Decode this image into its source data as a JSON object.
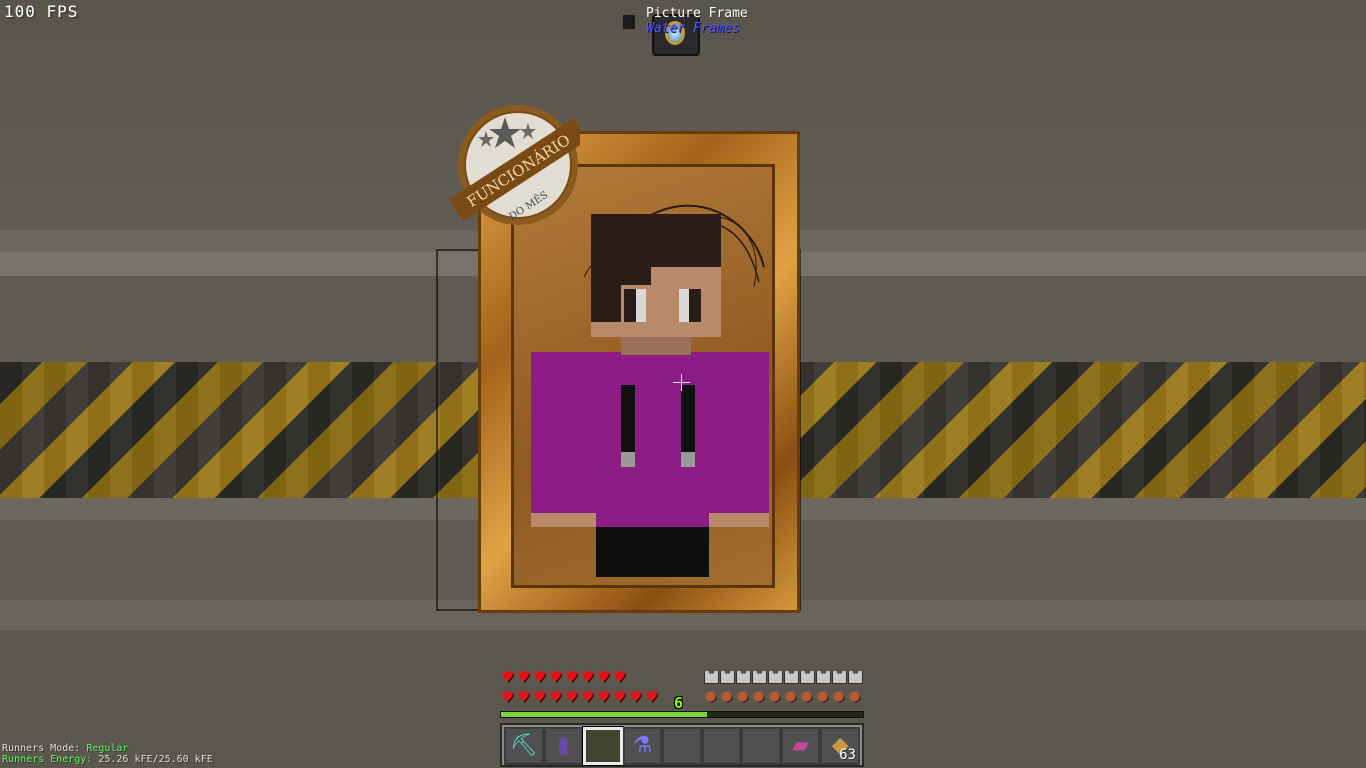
{
  "hud": {
    "fps": "100 FPS",
    "level": "6",
    "hearts_row1": 8,
    "hearts_row2": 10,
    "armor_points": 10,
    "hunger_points": 10,
    "xp_progress": 0.57
  },
  "waila": {
    "block_name": "Picture Frame",
    "mod_name": "Water Frames"
  },
  "painting": {
    "badge_line1": "FUNCIONÁRIO",
    "badge_line2": "DO MÊS"
  },
  "runners": {
    "mode_label": "Runners Mode:",
    "mode_value": "Regular",
    "energy_label": "Runners Energy:",
    "energy_value": "25.26 kFE/25.60 kFE"
  },
  "hotbar": {
    "selected_index": 2,
    "slots": [
      {
        "icon": "diamond-pickaxe-icon",
        "glyph": "⛏",
        "color": "#4fe0d0",
        "count": ""
      },
      {
        "icon": "purple-block-icon",
        "glyph": "▮",
        "color": "#6a4aa8",
        "count": ""
      },
      {
        "icon": "empty-slot",
        "glyph": "",
        "color": "#000000",
        "count": ""
      },
      {
        "icon": "potion-icon",
        "glyph": "⚗",
        "color": "#7a7aff",
        "count": ""
      },
      {
        "icon": "empty-slot",
        "glyph": "",
        "color": "#000000",
        "count": ""
      },
      {
        "icon": "empty-slot",
        "glyph": "",
        "color": "#000000",
        "count": ""
      },
      {
        "icon": "empty-slot",
        "glyph": "",
        "color": "#000000",
        "count": ""
      },
      {
        "icon": "enchanted-book-icon",
        "glyph": "▰",
        "color": "#c04a9a",
        "count": ""
      },
      {
        "icon": "bread-icon",
        "glyph": "◆",
        "color": "#c99a42",
        "count": "63"
      }
    ]
  },
  "colors": {
    "heart": "#e01616",
    "xp": "#7fd13a",
    "waila_mod": "#5555ff",
    "runners_value": "#55ff55"
  }
}
